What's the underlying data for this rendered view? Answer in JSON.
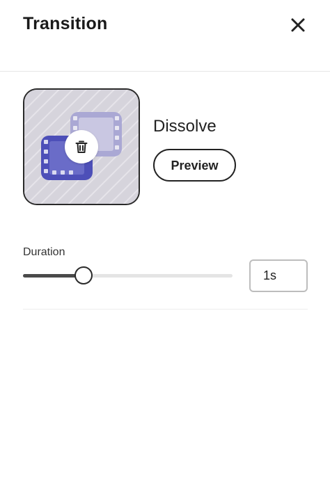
{
  "panel": {
    "title": "Transition",
    "close_icon": "close-icon"
  },
  "transition": {
    "name": "Dissolve",
    "thumbnail_icon": "film-strip-icon",
    "delete_icon": "trash-icon",
    "preview_label": "Preview"
  },
  "duration": {
    "label": "Duration",
    "value": "1s",
    "slider_fraction": 0.29
  },
  "colors": {
    "film_primary": "#4d4fb8",
    "film_secondary": "#aaa8d4",
    "thumbnail_bg": "#d6d4dc"
  }
}
